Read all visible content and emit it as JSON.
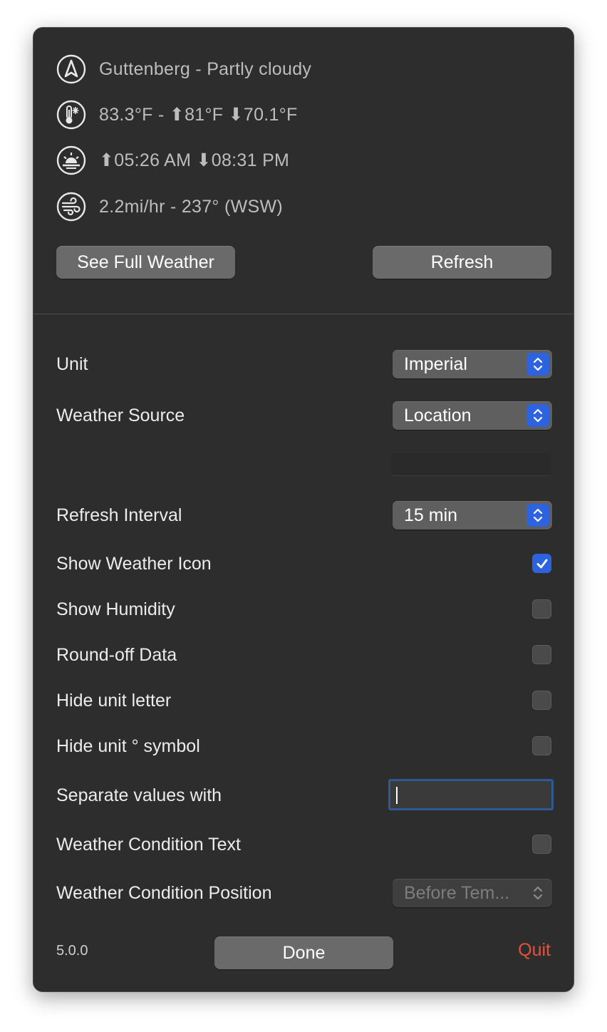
{
  "weather": {
    "location_line": "Guttenberg - Partly cloudy",
    "temperature_line": "83.3°F - ⬆81°F ⬇70.1°F",
    "sun_line": "⬆05:26 AM ⬇08:31 PM",
    "wind_line": "2.2mi/hr - 237° (WSW)"
  },
  "actions": {
    "see_full_weather": "See Full Weather",
    "refresh": "Refresh"
  },
  "settings": {
    "unit": {
      "label": "Unit",
      "value": "Imperial"
    },
    "weather_source": {
      "label": "Weather Source",
      "value": "Location",
      "extra_field_value": ""
    },
    "refresh_interval": {
      "label": "Refresh Interval",
      "value": "15 min"
    },
    "show_weather_icon": {
      "label": "Show Weather Icon",
      "checked": true
    },
    "show_humidity": {
      "label": "Show Humidity",
      "checked": false
    },
    "round_off_data": {
      "label": "Round-off Data",
      "checked": false
    },
    "hide_unit_letter": {
      "label": "Hide unit letter",
      "checked": false
    },
    "hide_unit_symbol": {
      "label": "Hide unit ° symbol",
      "checked": false
    },
    "separate_values_with": {
      "label": "Separate values with",
      "value": ""
    },
    "weather_condition_text": {
      "label": "Weather Condition Text",
      "checked": false
    },
    "weather_condition_position": {
      "label": "Weather Condition Position",
      "value": "Before Tem...",
      "disabled": true
    }
  },
  "footer": {
    "version": "5.0.0",
    "done": "Done",
    "quit": "Quit"
  },
  "colors": {
    "panel_bg": "#2d2d2d",
    "accent_blue": "#2e63e0",
    "quit_red": "#e0533f"
  }
}
